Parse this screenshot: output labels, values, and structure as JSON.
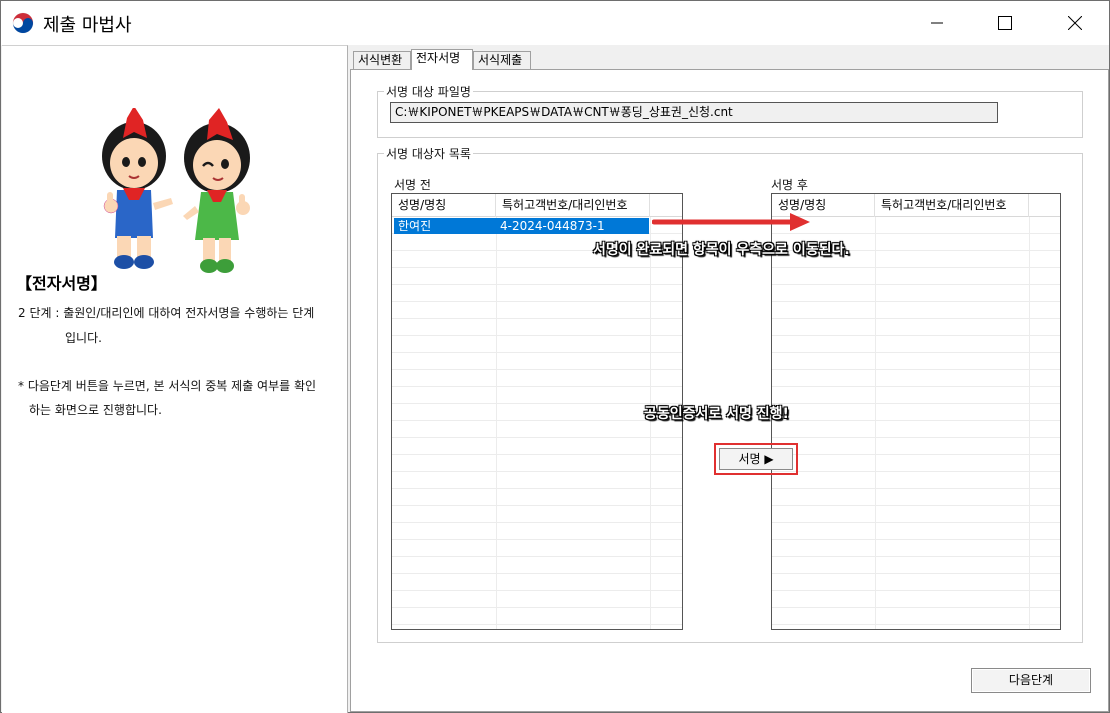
{
  "window": {
    "title": "제출 마법사"
  },
  "left_panel": {
    "section_title": "【전자서명】",
    "step_desc_line1": "2 단계 : 출원인/대리인에 대하여 전자서명을 수행하는 단계",
    "step_desc_line2": "입니다.",
    "note_line1": "* 다음단계 버튼을 누르면, 본 서식의 중복 제출 여부를 확인",
    "note_line2": "하는 화면으로 진행합니다."
  },
  "tabs": [
    {
      "label": "서식변환",
      "active": false
    },
    {
      "label": "전자서명",
      "active": true
    },
    {
      "label": "서식제출",
      "active": false
    }
  ],
  "file_group": {
    "legend": "서명 대상 파일명",
    "path": "C:￦KIPONET￦PKEAPS￦DATA￦CNT￦퐁딩_상표권_신청.cnt"
  },
  "signer_group": {
    "legend": "서명 대상자 목록",
    "before": {
      "label": "서명 전",
      "columns": [
        "성명/명칭",
        "특허고객번호/대리인번호"
      ],
      "rows": [
        {
          "name": "한여진",
          "number": "4-2024-044873-1",
          "selected": true
        }
      ]
    },
    "after": {
      "label": "서명 후",
      "columns": [
        "성명/명칭",
        "특허고객번호/대리인번호"
      ],
      "rows": []
    },
    "sign_button": "서명 ▶"
  },
  "annotations": {
    "move_note": "서명이 완료되면 항목이 우측으로 이동된다.",
    "cert_note": "공동인증서로 서명 진행!"
  },
  "footer": {
    "next_button": "다음단계"
  },
  "colors": {
    "selection": "#0078d7",
    "highlight_red": "#e03030"
  }
}
